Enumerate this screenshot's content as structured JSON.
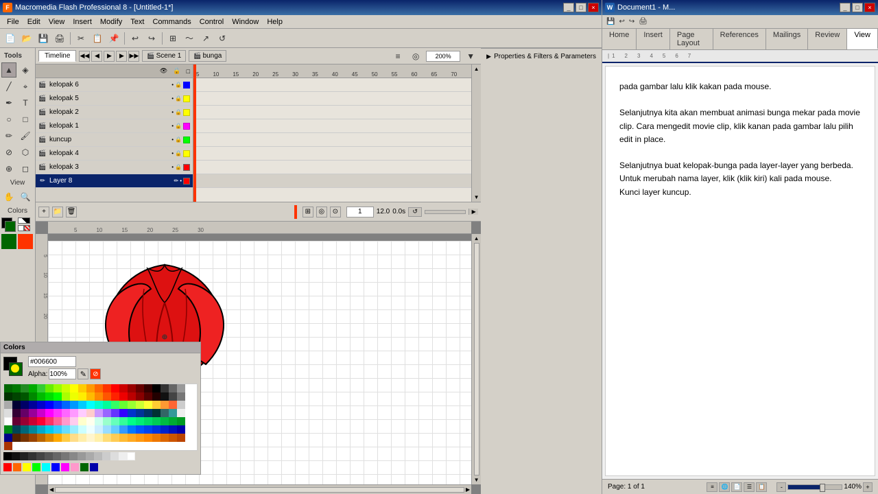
{
  "flash": {
    "title": "Macromedia Flash Professional 8 - [Untitled-1*]",
    "menu": [
      "File",
      "Edit",
      "View",
      "Insert",
      "Modify",
      "Text",
      "Commands",
      "Control",
      "Window",
      "Help"
    ],
    "timeline": {
      "tab": "Timeline",
      "scenes": [
        "Scene 1",
        "bunga"
      ],
      "fps": "12.0",
      "time": "0.0s",
      "frame": "1",
      "zoom": "200%",
      "layers": [
        {
          "name": "kelopak 6",
          "color": "#0000ff",
          "selected": false
        },
        {
          "name": "kelopak 5",
          "color": "#ffff00",
          "selected": false
        },
        {
          "name": "kelopak 2",
          "color": "#ffff00",
          "selected": false
        },
        {
          "name": "kelopak 1",
          "color": "#ff00ff",
          "selected": false
        },
        {
          "name": "kuncup",
          "color": "#00ff00",
          "selected": false
        },
        {
          "name": "kelopak 4",
          "color": "#ffff00",
          "selected": false
        },
        {
          "name": "kelopak 3",
          "color": "#ff0000",
          "selected": false
        },
        {
          "name": "Layer 8",
          "color": "#ff0000",
          "selected": true
        }
      ]
    },
    "colors": {
      "hex": "#006600",
      "alpha": "100%",
      "fill": "#006600",
      "stroke": "#000000"
    },
    "properties_bar": "Properties & Filters & Parameters"
  },
  "word": {
    "title": "Document1 - M...",
    "tabs": [
      "Home",
      "Insert",
      "Page Layout",
      "References",
      "Mailings",
      "Review",
      "View"
    ],
    "active_tab": "View",
    "content": [
      "pada gambar lalu klik kakan pada mouse.",
      "",
      "Selanjutnya kita akan membuat animasi bunga mekar pada movie clip. Cara mengedit movie clip, klik kanan pada gambar lalu pilih edit in place.",
      "",
      "Selanjutnya buat kelopak-bunga pada layer-layer yang berbeda.",
      " Untuk merubah nama layer, klik (klik kiri) kali pada mouse.",
      "Kunci layer kuncup."
    ],
    "status": {
      "page": "Page: 1 of 1",
      "zoom": "140%"
    }
  },
  "tools": {
    "items": [
      "V",
      "A",
      "P",
      "T",
      "O",
      "R",
      "✏",
      "B",
      "S",
      "E",
      "D",
      "I",
      "H",
      "Z"
    ],
    "view_label": "View",
    "colors_label": "Colors"
  }
}
